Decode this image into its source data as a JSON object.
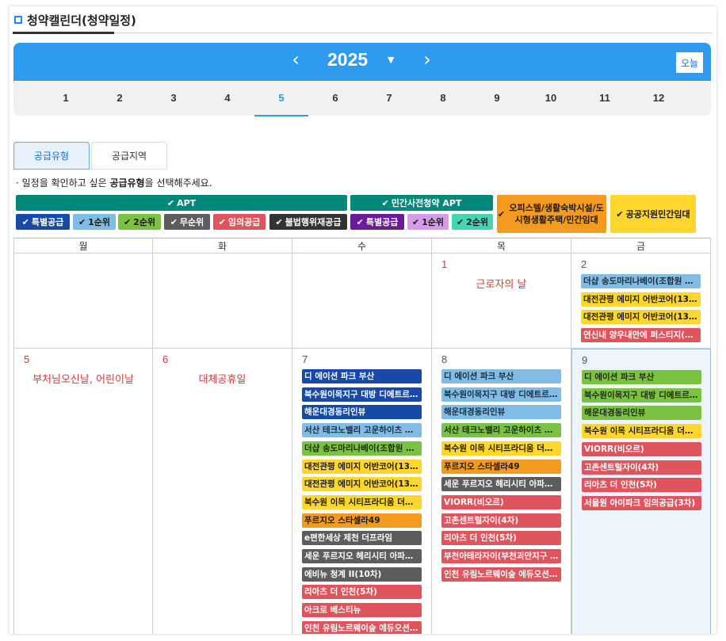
{
  "page_title": "청약캘린더(청약일정)",
  "header": {
    "year": "2025",
    "prev_icon": "chevron-left-icon",
    "next_icon": "chevron-right-icon",
    "dropdown_icon": "caret-down-icon",
    "today_label": "오늘",
    "colors": {
      "bar": "#2e9bee",
      "accent": "#1e6fc8"
    }
  },
  "months": [
    "1",
    "2",
    "3",
    "4",
    "5",
    "6",
    "7",
    "8",
    "9",
    "10",
    "11",
    "12"
  ],
  "active_month": "5",
  "tabs": [
    "공급유형",
    "공급지역"
  ],
  "active_tab": "공급유형",
  "instruction": {
    "prefix": "· 일정을 확인하고 싶은 ",
    "bold": "공급유형",
    "suffix": "을 선택해주세요."
  },
  "legend": {
    "groups": [
      {
        "label": "APT",
        "color": "#00897b"
      },
      {
        "label": "민간사전청약 APT",
        "color": "#00897b"
      },
      {
        "label": "오피스텔/생활숙박시설/도시형생활주택/민간임대",
        "color": "#f39a1f"
      },
      {
        "label": "공공지원민간임대",
        "color": "#ffd62e"
      }
    ],
    "chips": [
      {
        "label": "특별공급",
        "color": "#1749a8"
      },
      {
        "label": "1순위",
        "color": "#7fbde6"
      },
      {
        "label": "2순위",
        "color": "#7cc242"
      },
      {
        "label": "무순위",
        "color": "#5d5d5d"
      },
      {
        "label": "임의공급",
        "color": "#e0555d"
      },
      {
        "label": "불법행위재공급",
        "color": "#333333"
      },
      {
        "label": "특별공급",
        "color": "#6a1b9a"
      },
      {
        "label": "1순위",
        "color": "#d39be8"
      },
      {
        "label": "2순위",
        "color": "#43d6b5"
      }
    ],
    "check_icon": "check-icon"
  },
  "weekdays": [
    "월",
    "화",
    "수",
    "목",
    "금"
  ],
  "weeks": [
    [
      {
        "day": "",
        "events": []
      },
      {
        "day": "",
        "events": []
      },
      {
        "day": "",
        "events": []
      },
      {
        "day": "1",
        "holiday": "근로자의 날",
        "events": []
      },
      {
        "day": "2",
        "events": [
          {
            "label": "더샵 송도마리나베이(조합원 자…",
            "type": "r1"
          },
          {
            "label": "대전관평 에미지 어반코어(1345)",
            "type": "public"
          },
          {
            "label": "대전관평 에미지 어반코어(1356)",
            "type": "public"
          },
          {
            "label": "연신내 양우내안에 퍼스티지(8차)",
            "type": "random"
          }
        ]
      }
    ],
    [
      {
        "day": "5",
        "holiday": "부처님오신날, 어린이날",
        "events": []
      },
      {
        "day": "6",
        "holiday": "대체공휴일",
        "events": []
      },
      {
        "day": "7",
        "events": [
          {
            "label": "디 에이션 파크 부산",
            "type": "special"
          },
          {
            "label": "북수원이목지구 대방 디에트르 …",
            "type": "special"
          },
          {
            "label": "해운대경동리인뷰",
            "type": "special"
          },
          {
            "label": "서산 테크노밸리 고운하이츠 우…",
            "type": "r1"
          },
          {
            "label": "더샵 송도마리나베이(조합원 자…",
            "type": "r2"
          },
          {
            "label": "대전관평 에미지 어반코어(1345)",
            "type": "public"
          },
          {
            "label": "대전관평 에미지 어반코어(1356)",
            "type": "public"
          },
          {
            "label": "북수원 이목 시티프라디움 더블…",
            "type": "public"
          },
          {
            "label": "푸르지오 스타셀라49",
            "type": "office"
          },
          {
            "label": "e편한세상 제천 더프라임",
            "type": "none"
          },
          {
            "label": "세운 푸르지오 헤리시티 아파트 …",
            "type": "none"
          },
          {
            "label": "에비뉴 청계 II(10차)",
            "type": "none"
          },
          {
            "label": "리아츠 더 인천(5차)",
            "type": "random"
          },
          {
            "label": "아크로 베스티뉴",
            "type": "random"
          },
          {
            "label": "인천 유림노르웨이숲 에듀오션(…",
            "type": "random"
          }
        ]
      },
      {
        "day": "8",
        "events": [
          {
            "label": "디 에이션 파크 부산",
            "type": "r1"
          },
          {
            "label": "북수원이목지구 대방 디에트르 …",
            "type": "r1"
          },
          {
            "label": "해운대경동리인뷰",
            "type": "r1"
          },
          {
            "label": "서산 테크노밸리 고운하이츠 우…",
            "type": "r2"
          },
          {
            "label": "북수원 이목 시티프라디움 더블…",
            "type": "public"
          },
          {
            "label": "푸르지오 스타셀라49",
            "type": "office"
          },
          {
            "label": "세운 푸르지오 헤리시티 아파트 …",
            "type": "none"
          },
          {
            "label": "VIORR(비오르)",
            "type": "random"
          },
          {
            "label": "고촌센트럴자이(4차)",
            "type": "random"
          },
          {
            "label": "리아츠 더 인천(5차)",
            "type": "random"
          },
          {
            "label": "부천아테라자이(부천괴안지구 …",
            "type": "random"
          },
          {
            "label": "인천 유림노르웨이숲 에듀오션(…",
            "type": "random"
          }
        ]
      },
      {
        "day": "9",
        "today": true,
        "events": [
          {
            "label": "디 에이션 파크 부산",
            "type": "r2"
          },
          {
            "label": "북수원이목지구 대방 디에트르 …",
            "type": "r2"
          },
          {
            "label": "해운대경동리인뷰",
            "type": "r2"
          },
          {
            "label": "북수원 이목 시티프라디움 더블…",
            "type": "public"
          },
          {
            "label": "VIORR(비오르)",
            "type": "random"
          },
          {
            "label": "고촌센트럴자이(4차)",
            "type": "random"
          },
          {
            "label": "리아츠 더 인천(5차)",
            "type": "random"
          },
          {
            "label": "서울원 아이파크 임의공급(3차)",
            "type": "random"
          }
        ]
      }
    ]
  ]
}
